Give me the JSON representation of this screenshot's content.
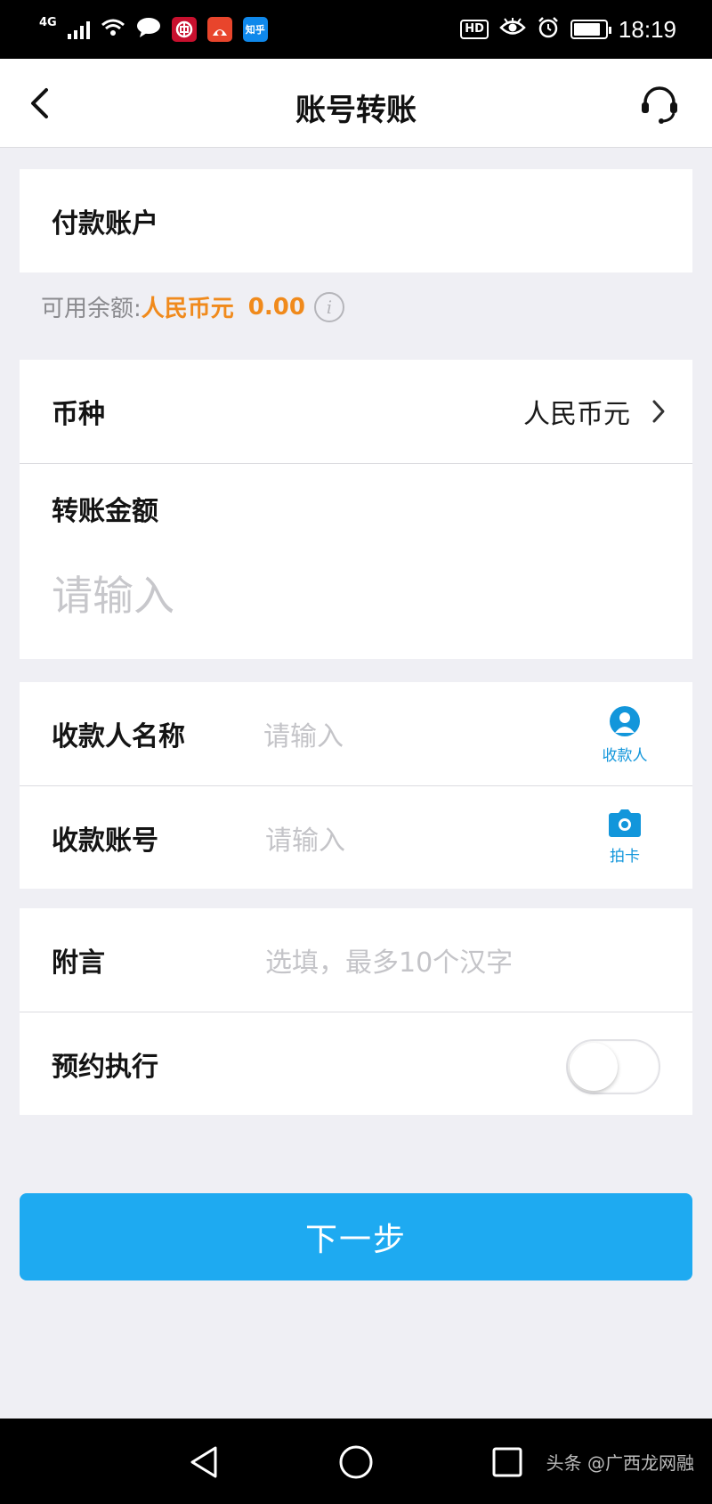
{
  "status_bar": {
    "network": "4G",
    "zhihu_label": "知乎",
    "hd": "HD",
    "time": "18:19"
  },
  "header": {
    "title": "账号转账"
  },
  "payer": {
    "label": "付款账户"
  },
  "balance": {
    "label": "可用余额:",
    "currency": "人民币元",
    "amount": "0.00",
    "info_glyph": "i"
  },
  "currency_row": {
    "label": "币种",
    "value": "人民币元"
  },
  "amount": {
    "label": "转账金额",
    "placeholder": "请输入"
  },
  "payee_name": {
    "label": "收款人名称",
    "placeholder": "请输入",
    "action_label": "收款人"
  },
  "payee_account": {
    "label": "收款账号",
    "placeholder": "请输入",
    "action_label": "拍卡"
  },
  "memo": {
    "label": "附言",
    "placeholder": "选填，最多10个汉字"
  },
  "schedule": {
    "label": "预约执行",
    "enabled": false
  },
  "next_button": {
    "label": "下一步"
  },
  "watermark": "头条 @广西龙网融",
  "colors": {
    "accent": "#1eaaf1",
    "balance": "#f08a1c",
    "icon_blue": "#1296db"
  }
}
